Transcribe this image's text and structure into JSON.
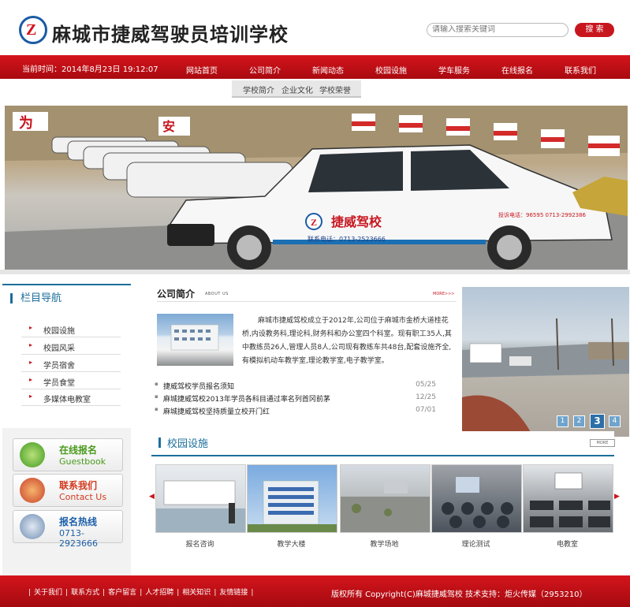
{
  "header": {
    "site_title": "麻城市捷威驾驶员培训学校",
    "search_placeholder": "请输入搜索关键词",
    "search_button": "搜 索"
  },
  "navbar": {
    "datetime": "当前时间：2014年8月23日 19:12:07",
    "items": [
      "网站首页",
      "公司简介",
      "新闻动态",
      "校园设施",
      "学车服务",
      "在线报名",
      "联系我们"
    ]
  },
  "subnav": {
    "items": [
      "学校简介",
      "企业文化",
      "学校荣誉"
    ]
  },
  "banner": {
    "sign_text": "为",
    "sign_text2": "安",
    "car_brand": "捷威驾校",
    "car_phone": "联系电话：0713-2523666",
    "car_side_phone": "投诉电话：96595 0713-2992386"
  },
  "sidebar": {
    "title": "栏目导航",
    "items": [
      "校园设施",
      "校园风采",
      "学员宿舍",
      "学员食堂",
      "多媒体电教室"
    ],
    "promo_signup": {
      "title": "在线报名",
      "subtitle": "Guestbook"
    },
    "promo_contact": {
      "title": "联系我们",
      "subtitle": "Contact Us"
    },
    "promo_hotline": {
      "title": "报名热线",
      "subtitle": "0713-2923666"
    }
  },
  "about": {
    "title": "公司简介",
    "subtitle": "ABOUT US",
    "more": "MORE>>>",
    "text": "麻城市捷威驾校成立于2012年,公司位于麻城市金桥大道桂花桥,内设教务科,理论科,财务科和办公室四个科室。现有职工35人,其中教练员26人,管理人员8人,公司现有教练车共48台,配套设施齐全,有模拟机动车教学室,理论教学室,电子教学室。"
  },
  "news": [
    {
      "title": "捷威驾校学员报名须知",
      "date": "05/25"
    },
    {
      "title": "麻城捷威驾校2013年学员各科目通过率名列首冈前茅",
      "date": "12/25"
    },
    {
      "title": "麻城捷威驾校坚持质量立校开门红",
      "date": "07/01"
    }
  ],
  "slideshow": {
    "pages": [
      "1",
      "2",
      "3",
      "4"
    ],
    "active": "3"
  },
  "campus": {
    "title": "校园设施",
    "more": "MORE",
    "items": [
      "报名咨询",
      "教学大楼",
      "教学场地",
      "理论测试",
      "电教室"
    ]
  },
  "footer": {
    "links": [
      "关于我们",
      "联系方式",
      "客户留言",
      "人才招聘",
      "相关知识",
      "友情链接"
    ],
    "copyright": "版权所有 Copyright(C)麻城捷威驾校 技术支持：炬火传媒（2953210）"
  },
  "colors": {
    "brand_red": "#c8161f",
    "accent_blue": "#1b6e9b"
  }
}
